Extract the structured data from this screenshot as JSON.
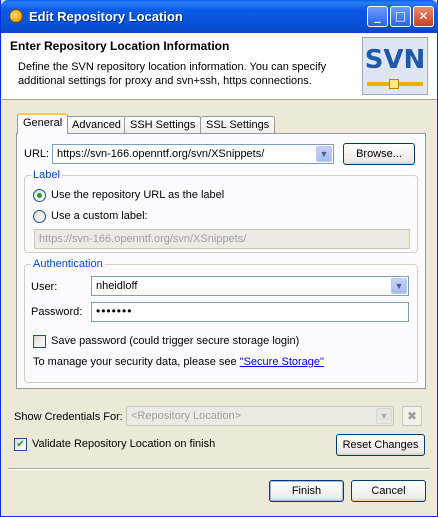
{
  "window": {
    "title": "Edit Repository Location"
  },
  "header": {
    "title": "Enter Repository Location Information",
    "description": "Define the SVN repository location information. You can specify additional settings for proxy and svn+ssh, https connections.",
    "logo_text": "SVN"
  },
  "tabs": [
    {
      "label": "General",
      "active": true
    },
    {
      "label": "Advanced"
    },
    {
      "label": "SSH Settings"
    },
    {
      "label": "SSL Settings"
    }
  ],
  "url": {
    "label": "URL:",
    "value": "https://svn-166.openntf.org/svn/XSnippets/",
    "browse_label": "Browse..."
  },
  "label_group": {
    "title": "Label",
    "option_repo_url": "Use the repository URL as the label",
    "option_custom": "Use a custom label:",
    "custom_value": "https://svn-166.openntf.org/svn/XSnippets/"
  },
  "auth_group": {
    "title": "Authentication",
    "user_label": "User:",
    "user_value": "nheidloff",
    "password_label": "Password:",
    "password_value": "•••••••",
    "save_password_label": "Save password (could trigger secure storage login)",
    "manage_text": "To manage your security data, please see ",
    "secure_storage_link": "\"Secure Storage\""
  },
  "credentials": {
    "label": "Show Credentials For:",
    "placeholder": "<Repository Location>"
  },
  "validate": {
    "label": "Validate Repository Location on finish",
    "checked": true
  },
  "buttons": {
    "reset": "Reset Changes",
    "finish": "Finish",
    "cancel": "Cancel"
  }
}
